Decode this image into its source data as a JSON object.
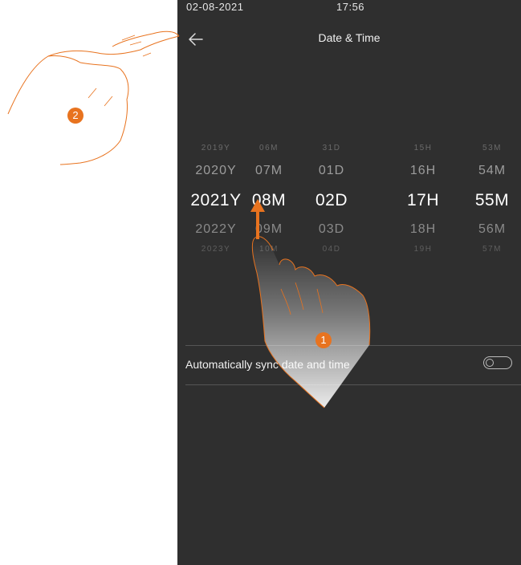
{
  "status_bar": {
    "date": "02-08-2021",
    "time": "17:56"
  },
  "header": {
    "title": "Date & Time",
    "back_icon": "back-arrow-icon"
  },
  "picker": {
    "rows": [
      [
        "2019Y",
        "06M",
        "31D",
        "15H",
        "53M"
      ],
      [
        "2020Y",
        "07M",
        "01D",
        "16H",
        "54M"
      ],
      [
        "2021Y",
        "08M",
        "02D",
        "17H",
        "55M"
      ],
      [
        "2022Y",
        "09M",
        "03D",
        "18H",
        "56M"
      ],
      [
        "2023Y",
        "10M",
        "04D",
        "19H",
        "57M"
      ]
    ],
    "selected_row": 2
  },
  "settings": {
    "auto_sync_label": "Automatically sync date and time",
    "auto_sync_enabled": false
  },
  "callouts": [
    "1",
    "2"
  ],
  "colors": {
    "screen_bg": "#2f2f2f",
    "accent": "#e8731f",
    "text": "#ffffff"
  }
}
